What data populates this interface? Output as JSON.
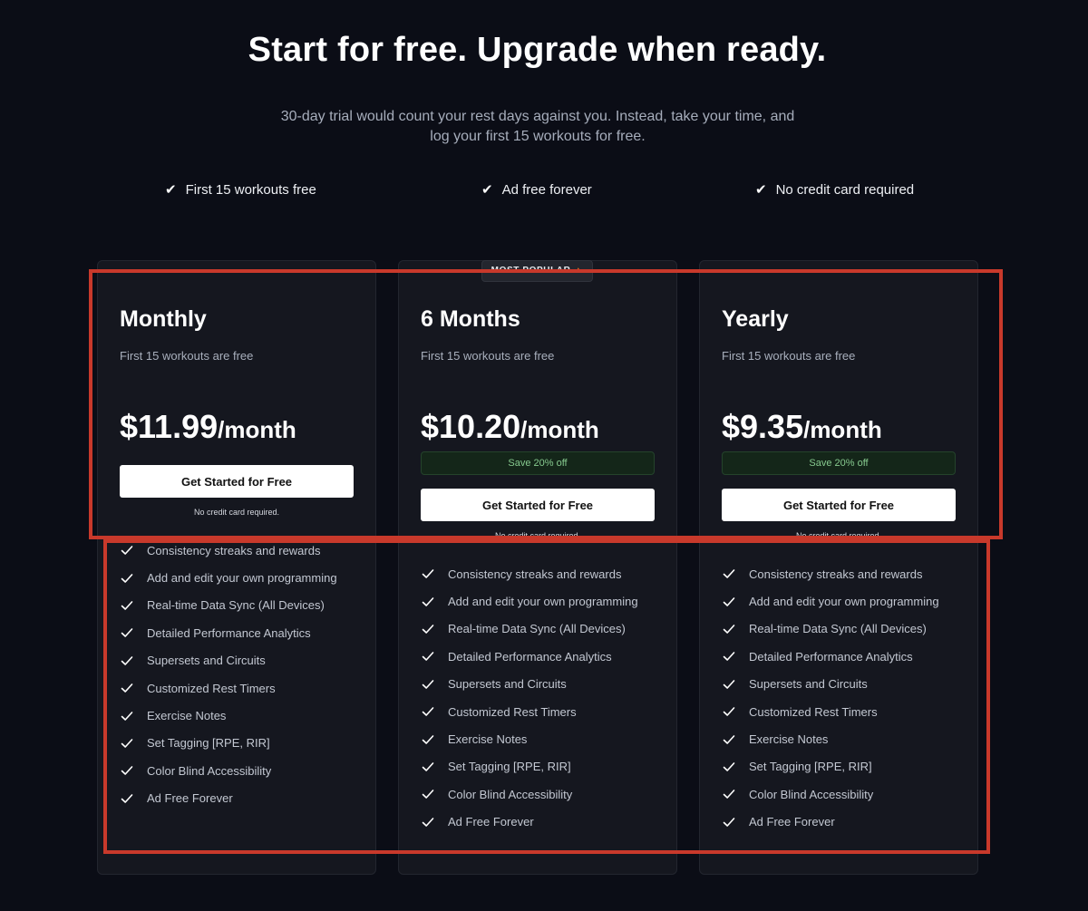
{
  "header": {
    "title": "Start for free. Upgrade when ready.",
    "subtitle_line1": "30-day trial would count your rest days against you. Instead, take your time, and",
    "subtitle_line2": "log your first 15 workouts for free."
  },
  "perks": [
    {
      "icon": "check-icon",
      "label": "First 15 workouts free"
    },
    {
      "icon": "check-icon",
      "label": "Ad free forever"
    },
    {
      "icon": "check-icon",
      "label": "No credit card required"
    }
  ],
  "popular_badge": "MOST POPULAR",
  "plans": [
    {
      "name": "Monthly",
      "note": "First 15 workouts are free",
      "price": "$11.99",
      "period": "/month",
      "save": "",
      "cta": "Get Started for Free",
      "cta_note": "No credit card required."
    },
    {
      "name": "6 Months",
      "note": "First 15 workouts are free",
      "price": "$10.20",
      "period": "/month",
      "save": "Save 20% off",
      "cta": "Get Started for Free",
      "cta_note": "No credit card required."
    },
    {
      "name": "Yearly",
      "note": "First 15 workouts are free",
      "price": "$9.35",
      "period": "/month",
      "save": "Save 20% off",
      "cta": "Get Started for Free",
      "cta_note": "No credit card required."
    }
  ],
  "features": [
    "Consistency streaks and rewards",
    "Add and edit your own programming",
    "Real-time Data Sync (All Devices)",
    "Detailed Performance Analytics",
    "Supersets and Circuits",
    "Customized Rest Timers",
    "Exercise Notes",
    "Set Tagging [RPE, RIR]",
    "Color Blind Accessibility",
    "Ad Free Forever"
  ],
  "colors": {
    "background": "#0b0d16",
    "card": "#15171f",
    "highlight": "#c8392b",
    "save_text": "#86c98e",
    "flame": "#f97316"
  }
}
